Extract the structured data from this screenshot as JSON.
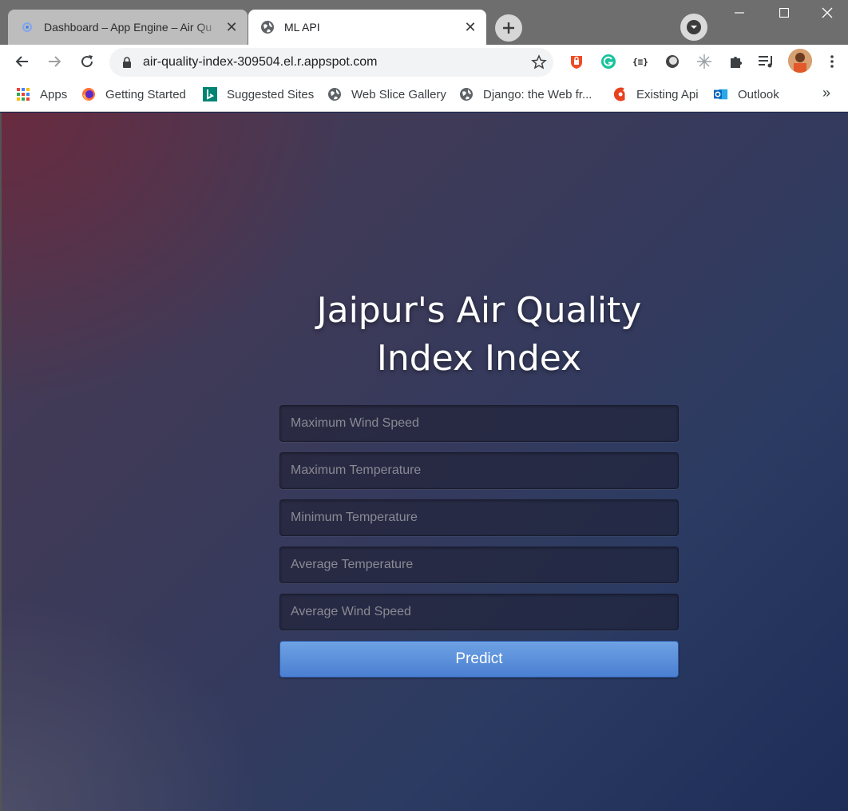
{
  "browser": {
    "tabs": [
      {
        "title": "Dashboard – App Engine – Air Qu",
        "icon": "app-engine-icon",
        "active": false
      },
      {
        "title": "ML API",
        "icon": "globe-icon",
        "active": true
      }
    ],
    "url": "air-quality-index-309504.el.r.appspot.com",
    "bookmarks": [
      {
        "label": "Apps",
        "icon": "apps-grid-icon"
      },
      {
        "label": "Getting Started",
        "icon": "firefox-icon"
      },
      {
        "label": "Suggested Sites",
        "icon": "bing-icon"
      },
      {
        "label": "Web Slice Gallery",
        "icon": "globe-icon"
      },
      {
        "label": "Django: the Web fr...",
        "icon": "globe-icon"
      },
      {
        "label": "Existing Api",
        "icon": "red-a-icon"
      },
      {
        "label": "Outlook",
        "icon": "outlook-icon"
      }
    ],
    "bookmarks_overflow": "»"
  },
  "page": {
    "heading_line1": "Jaipur's Air Quality",
    "heading_line2": "Index Index",
    "fields": [
      {
        "placeholder": "Maximum Wind Speed"
      },
      {
        "placeholder": "Maximum Temperature"
      },
      {
        "placeholder": "Minimum Temperature"
      },
      {
        "placeholder": "Average Temperature"
      },
      {
        "placeholder": "Average Wind Speed"
      }
    ],
    "predict_label": "Predict"
  },
  "colors": {
    "button_blue": "#4a7fd2",
    "background_dark": "#1d2d58",
    "background_maroon": "#6e283c"
  }
}
